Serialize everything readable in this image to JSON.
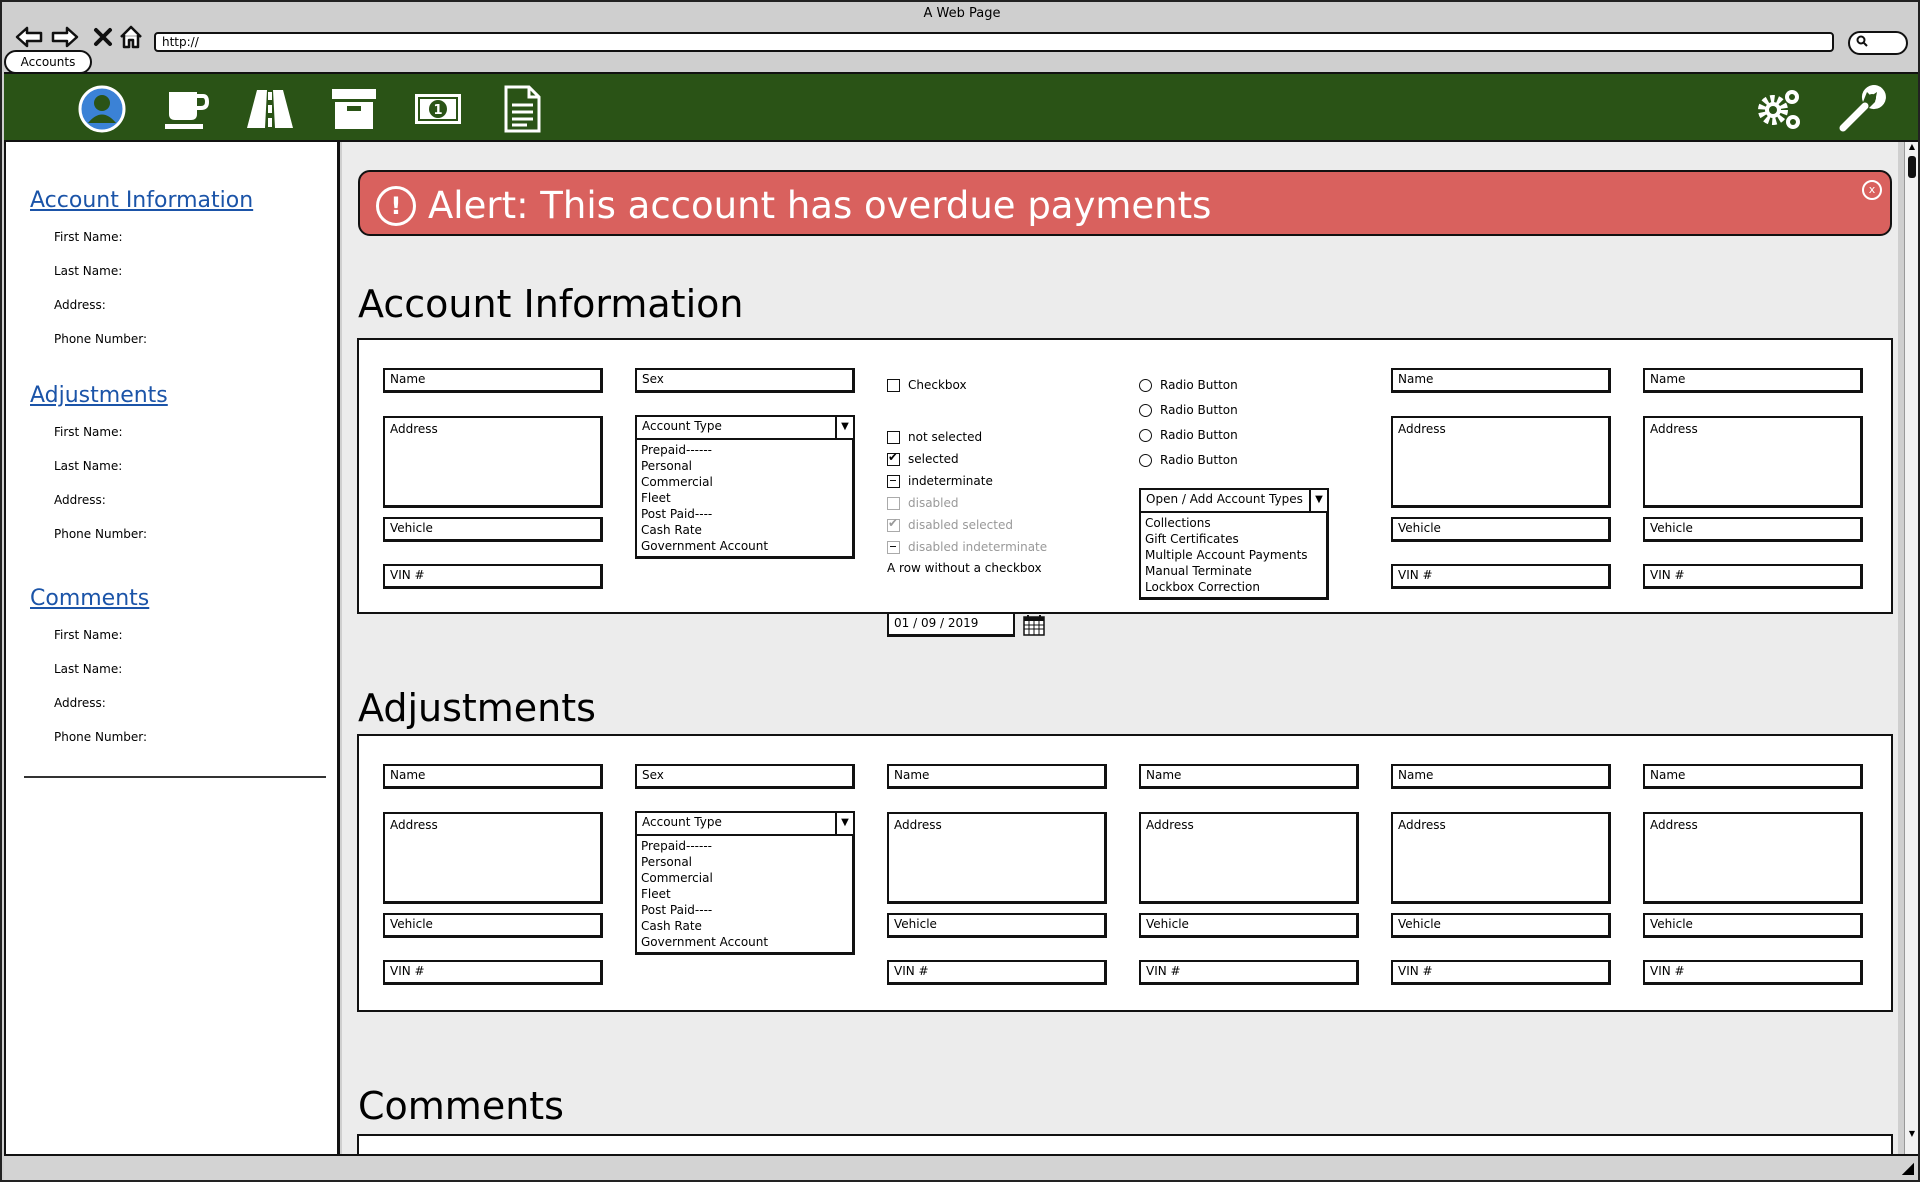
{
  "browser": {
    "title": "A Web Page",
    "url": "http://",
    "tab_label": "Accounts"
  },
  "toolbar": {
    "icons": [
      "user-icon",
      "coffee-cup-icon",
      "road-icon",
      "archive-box-icon",
      "money-icon",
      "document-icon",
      "gears-icon",
      "wrench-icon"
    ],
    "brand_color": "#2a5316"
  },
  "sidebar": {
    "sections": [
      {
        "heading": "Account Information",
        "items": [
          "First Name:",
          "Last Name:",
          "Address:",
          "Phone Number:"
        ]
      },
      {
        "heading": "Adjustments",
        "items": [
          "First Name:",
          "Last Name:",
          "Address:",
          "Phone Number:"
        ]
      },
      {
        "heading": "Comments",
        "items": [
          "First Name:",
          "Last Name:",
          "Address:",
          "Phone Number:"
        ]
      }
    ]
  },
  "alert": {
    "icon": "!",
    "text": "Alert: This account has overdue payments",
    "close": "x",
    "color": "#d9615e"
  },
  "account_info": {
    "title": "Account Information",
    "col1": {
      "name": "Name",
      "address": "Address",
      "vehicle": "Vehicle",
      "vin": "VIN #"
    },
    "col2": {
      "sex": "Sex",
      "account_type": "Account Type",
      "account_type_options": [
        "Prepaid------",
        "Personal",
        "Commercial",
        "Fleet",
        "Post Paid----",
        "Cash Rate",
        "Government Account"
      ]
    },
    "checkboxes": {
      "checkbox": "Checkbox",
      "not_selected": "not selected",
      "selected": "selected",
      "indeterminate": "indeterminate",
      "disabled": "disabled",
      "disabled_selected": "disabled selected",
      "disabled_indeterminate": "disabled indeterminate",
      "no_checkbox_row": "A row without a checkbox"
    },
    "date": "01  /  09  /  2019",
    "radios": [
      "Radio Button",
      "Radio Button",
      "Radio Button",
      "Radio Button"
    ],
    "add_types": {
      "label": "Open / Add Account Types",
      "options": [
        "Collections",
        "Gift Certificates",
        "Multiple Account Payments",
        "Manual Terminate",
        "Lockbox Correction"
      ]
    },
    "col5": {
      "name": "Name",
      "address": "Address",
      "vehicle": "Vehicle",
      "vin": "VIN #"
    },
    "col6": {
      "name": "Name",
      "address": "Address",
      "vehicle": "Vehicle",
      "vin": "VIN #"
    }
  },
  "adjustments": {
    "title": "Adjustments",
    "col1": {
      "name": "Name",
      "address": "Address",
      "vehicle": "Vehicle",
      "vin": "VIN #"
    },
    "col2": {
      "sex": "Sex",
      "account_type": "Account Type",
      "account_type_options": [
        "Prepaid------",
        "Personal",
        "Commercial",
        "Fleet",
        "Post Paid----",
        "Cash Rate",
        "Government Account"
      ]
    },
    "col3": {
      "name": "Name",
      "address": "Address",
      "vehicle": "Vehicle",
      "vin": "VIN #"
    },
    "col4": {
      "name": "Name",
      "address": "Address",
      "vehicle": "Vehicle",
      "vin": "VIN #"
    },
    "col5": {
      "name": "Name",
      "address": "Address",
      "vehicle": "Vehicle",
      "vin": "VIN #"
    },
    "col6": {
      "name": "Name",
      "address": "Address",
      "vehicle": "Vehicle",
      "vin": "VIN #"
    }
  },
  "comments": {
    "title": "Comments"
  }
}
